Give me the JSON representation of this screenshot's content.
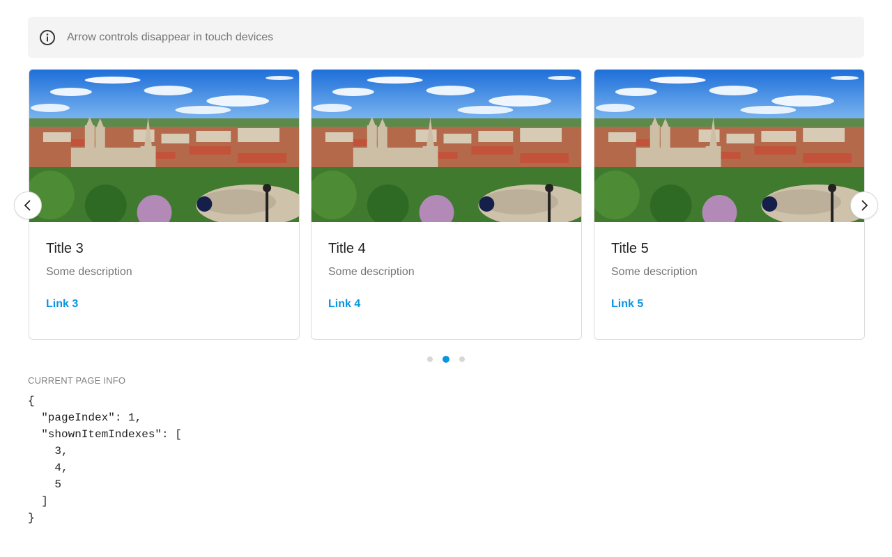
{
  "banner": {
    "icon": "info-icon",
    "text": "Arrow controls disappear in touch devices"
  },
  "carousel": {
    "prev_icon": "chevron-left-icon",
    "next_icon": "chevron-right-icon",
    "cards": [
      {
        "title": "Title 3",
        "description": "Some description",
        "link": "Link 3"
      },
      {
        "title": "Title 4",
        "description": "Some description",
        "link": "Link 4"
      },
      {
        "title": "Title 5",
        "description": "Some description",
        "link": "Link 5"
      }
    ],
    "pages": 3,
    "active_page": 1
  },
  "page_info": {
    "label": "CURRENT PAGE INFO",
    "code": "{\n  \"pageIndex\": 1,\n  \"shownItemIndexes\": [\n    3,\n    4,\n    5\n  ]\n}"
  },
  "colors": {
    "accent": "#0a94e0",
    "banner_bg": "#f4f4f4",
    "muted_text": "#757575"
  }
}
